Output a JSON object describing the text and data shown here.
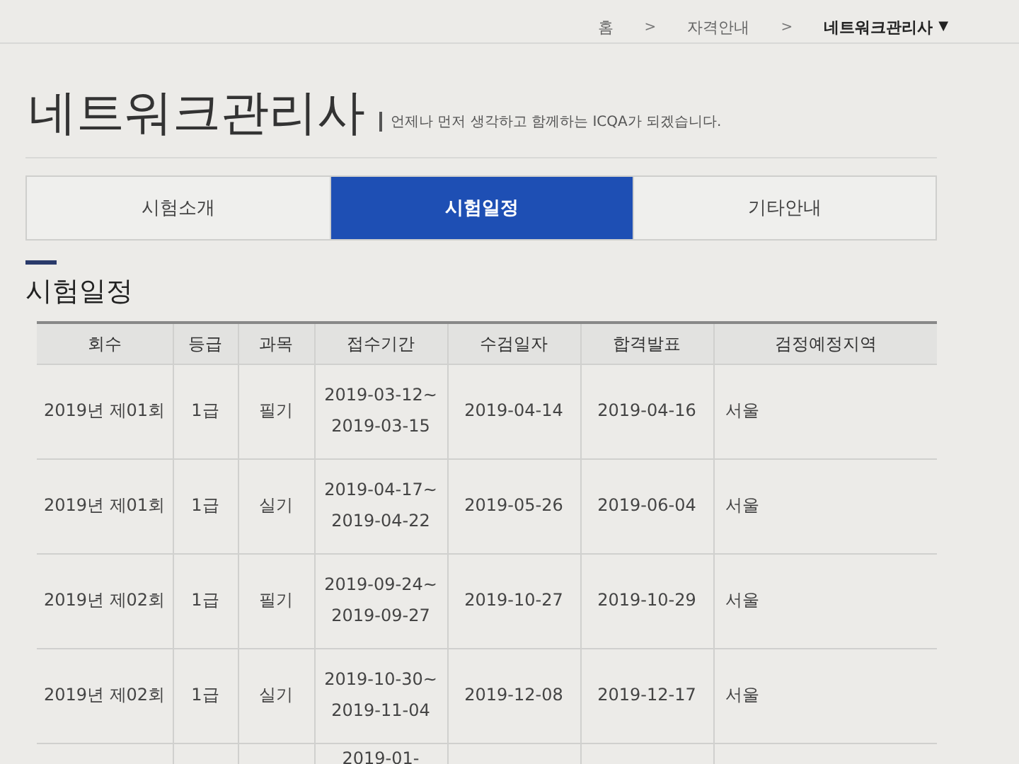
{
  "breadcrumb": [
    {
      "label": "홈"
    },
    {
      "label": "자격안내"
    },
    {
      "label": "네트워크관리사",
      "dropdown": true
    }
  ],
  "breadcrumb_separator": ">",
  "dropdown_glyph": "▼",
  "page_title": "네트워크관리사",
  "tagline": "언제나 먼저 생각하고 함께하는 ICQA가 되겠습니다.",
  "tabs": [
    {
      "label": "시험소개",
      "selected": false
    },
    {
      "label": "시험일정",
      "selected": true
    },
    {
      "label": "기타안내",
      "selected": false
    }
  ],
  "section_title": "시험일정",
  "table": {
    "columns": [
      "회수",
      "등급",
      "과목",
      "접수기간",
      "수검일자",
      "합격발표",
      "검정예정지역"
    ],
    "rows": [
      {
        "round": "2019년 제01회",
        "grade": "1급",
        "subject": "필기",
        "period": "2019-03-12~2019-03-15",
        "exam_date": "2019-04-14",
        "result_date": "2019-04-16",
        "region": "서울"
      },
      {
        "round": "2019년 제01회",
        "grade": "1급",
        "subject": "실기",
        "period": "2019-04-17~2019-04-22",
        "exam_date": "2019-05-26",
        "result_date": "2019-06-04",
        "region": "서울"
      },
      {
        "round": "2019년 제02회",
        "grade": "1급",
        "subject": "필기",
        "period": "2019-09-24~2019-09-27",
        "exam_date": "2019-10-27",
        "result_date": "2019-10-29",
        "region": "서울"
      },
      {
        "round": "2019년 제02회",
        "grade": "1급",
        "subject": "실기",
        "period": "2019-10-30~2019-11-04",
        "exam_date": "2019-12-08",
        "result_date": "2019-12-17",
        "region": "서울"
      },
      {
        "period": "2019-01-"
      }
    ]
  }
}
